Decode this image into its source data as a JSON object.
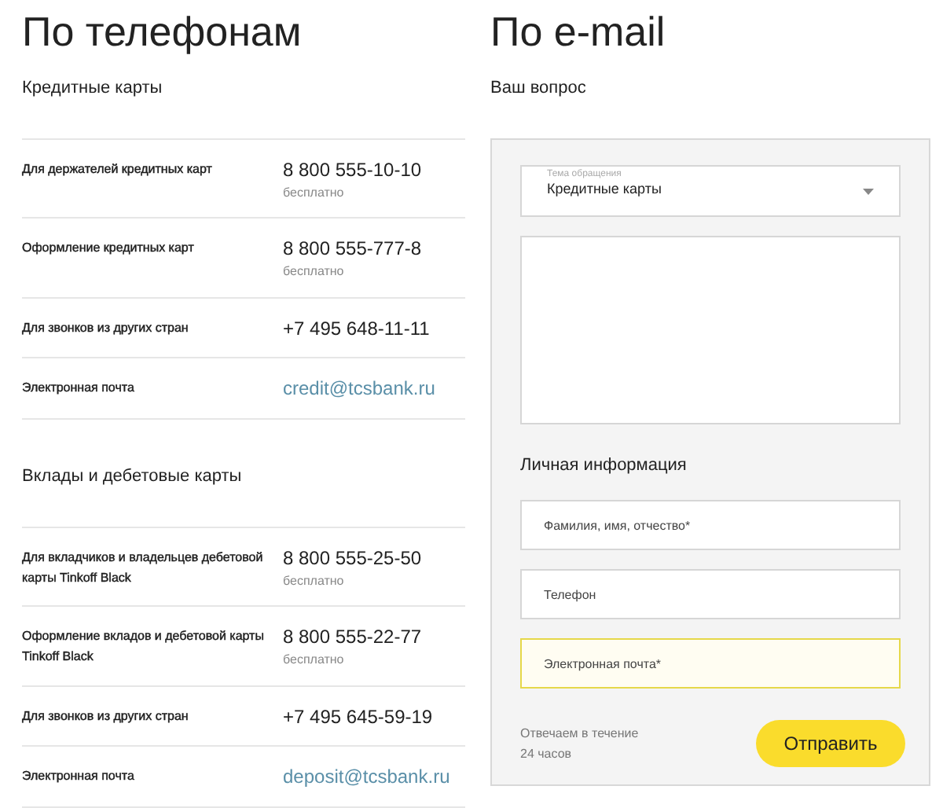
{
  "phone_section": {
    "title": "По телефонам",
    "groups": [
      {
        "title": "Кредитные карты",
        "rows": [
          {
            "kind": "phone",
            "label": "Для держателей кредитных карт",
            "value": "8 800 555-10-10",
            "note": "бесплатно"
          },
          {
            "kind": "phone",
            "label": "Оформление кредитных карт",
            "value": "8 800 555-777-8",
            "note": "бесплатно"
          },
          {
            "kind": "phone",
            "label": "Для звонков из других стран",
            "value": "+7 495 648-11-11"
          },
          {
            "kind": "email",
            "label": "Электронная почта",
            "value": "credit@tcsbank.ru"
          }
        ]
      },
      {
        "title": "Вклады и дебетовые карты",
        "rows": [
          {
            "kind": "phone",
            "label": "Для вкладчиков и владельцев дебетовой карты Tinkoff Black",
            "value": "8 800 555-25-50",
            "note": "бесплатно"
          },
          {
            "kind": "phone",
            "label": "Оформление вкладов и дебетовой карты Tinkoff Black",
            "value": "8 800 555-22-77",
            "note": "бесплатно"
          },
          {
            "kind": "phone",
            "label": "Для звонков из других стран",
            "value": "+7 495 645-59-19"
          },
          {
            "kind": "email",
            "label": "Электронная почта",
            "value": "deposit@tcsbank.ru"
          }
        ]
      }
    ]
  },
  "email_section": {
    "title": "По e-mail",
    "subtitle": "Ваш вопрос",
    "topic_select": {
      "label": "Тема обращения",
      "value": "Кредитные карты"
    },
    "personal_title": "Личная информация",
    "fields": [
      {
        "placeholder": "Фамилия, имя, отчество*",
        "focused": false
      },
      {
        "placeholder": "Телефон",
        "focused": false
      },
      {
        "placeholder": "Электронная почта*",
        "focused": true
      }
    ],
    "response_note": "Отвечаем в течение 24 часов",
    "submit_button": "Отправить"
  }
}
